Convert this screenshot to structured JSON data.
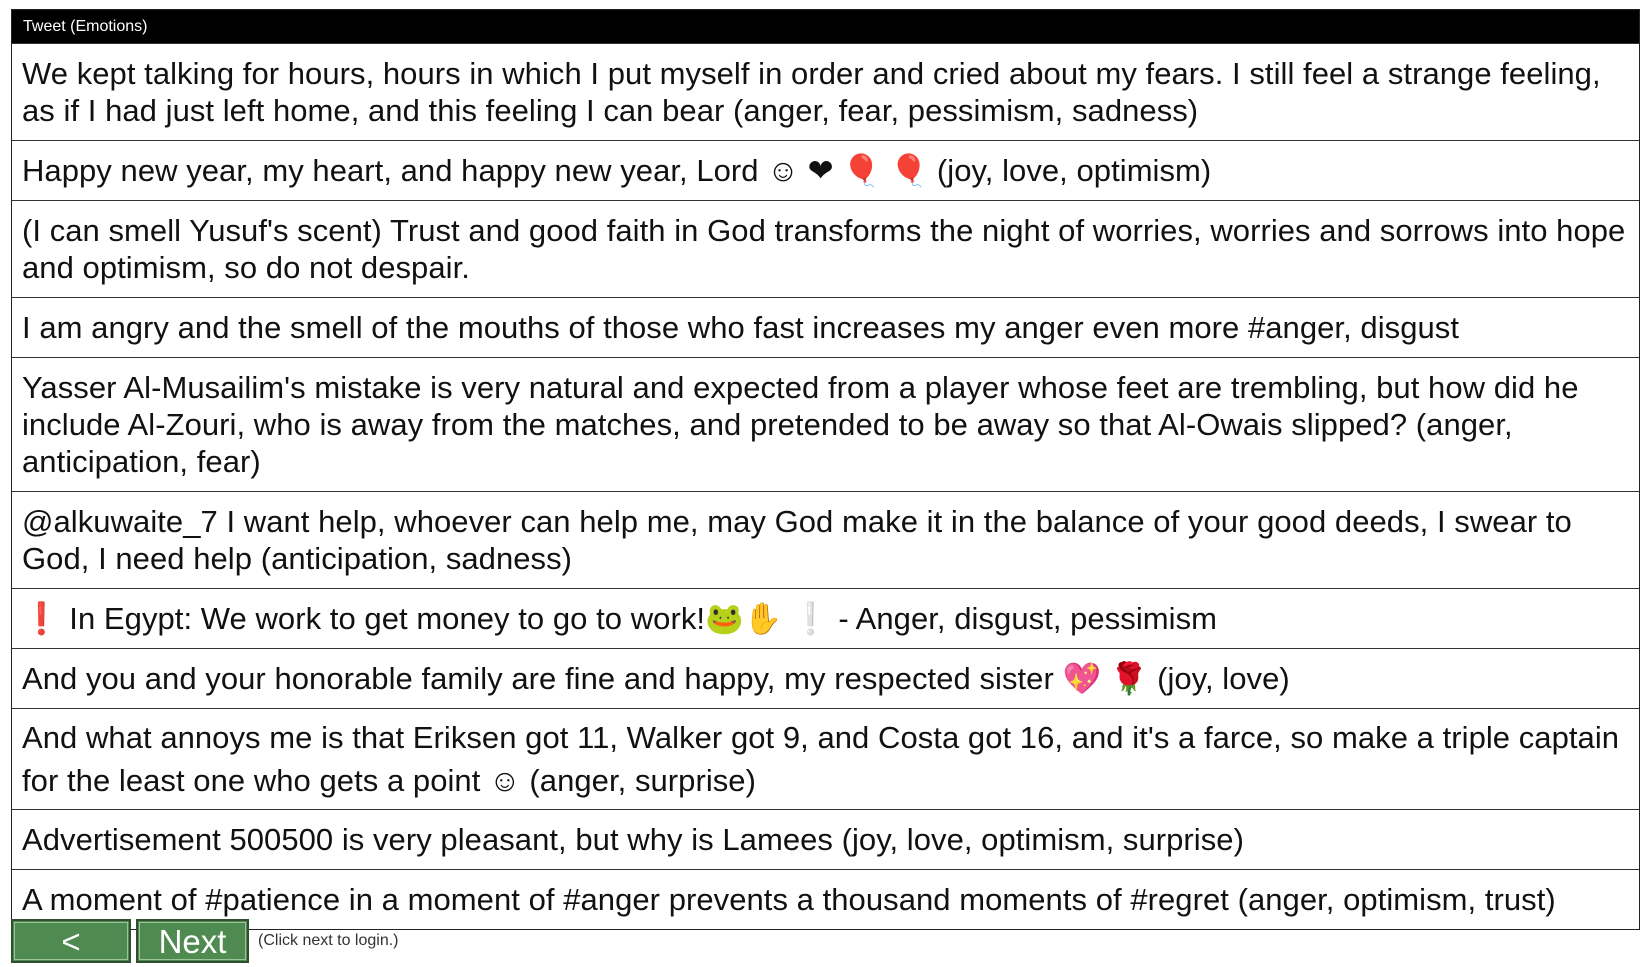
{
  "table": {
    "header": "Tweet (Emotions)",
    "rows": [
      "We kept talking for hours, hours in which I put myself in order and cried about my fears. I still feel a strange feeling, as if I had just left home, and this feeling I can bear (anger, fear, pessimism, sadness)",
      "Happy new year, my heart, and happy new year, Lord ☺ ❤ 🎈 🎈 (joy, love, optimism)",
      "(I can smell Yusuf's scent) Trust and good faith in God transforms the night of worries, worries and sorrows into hope and optimism, so do not despair.",
      "I am angry and the smell of the mouths of those who fast increases my anger even more #anger, disgust",
      "Yasser Al-Musailim's mistake is very natural and expected from a player whose feet are trembling, but how did he include Al-Zouri, who is away from the matches, and pretended to be away so that Al-Owais slipped? (anger, anticipation, fear)",
      "@alkuwaite_7 I want help, whoever can help me, may God make it in the balance of your good deeds, I swear to God, I need help (anticipation, sadness)",
      "❗ In Egypt: We work to get money to go to work!🐸✋ ❕ - Anger, disgust, pessimism",
      "And you and your honorable family are fine and happy, my respected sister 💖 🌹 (joy, love)",
      "And what annoys me is that Eriksen got 11, Walker got 9, and Costa got 16, and it's a farce, so make a triple captain for the least one who gets a point ☺ (anger, surprise)",
      "Advertisement 500500 is very pleasant, but why is Lamees (joy, love, optimism, surprise)",
      "A moment of #patience in a moment of #anger prevents a thousand moments of #regret (anger, optimism, trust)"
    ]
  },
  "nav": {
    "back_label": "< Back",
    "next_label": "Next >",
    "hint": "(Click next to login.)"
  }
}
